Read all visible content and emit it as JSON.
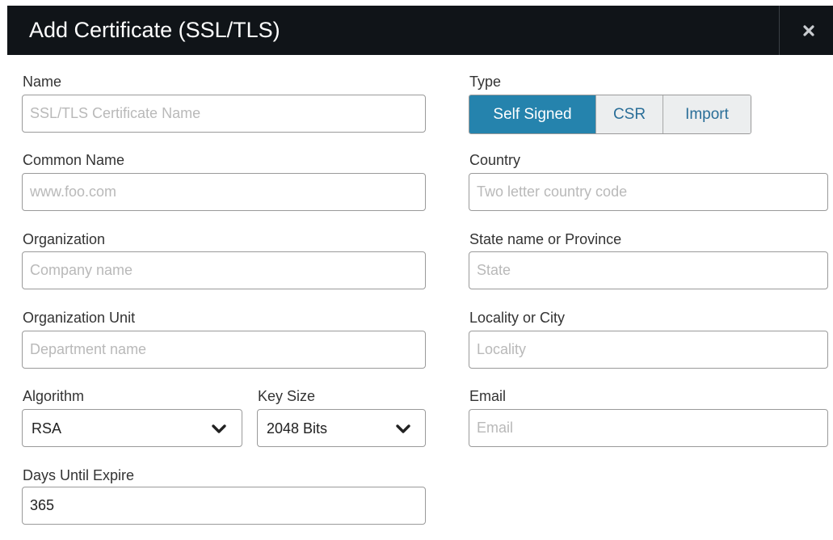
{
  "dialog": {
    "title": "Add Certificate (SSL/TLS)",
    "close_icon": "close-icon"
  },
  "form": {
    "name": {
      "label": "Name",
      "placeholder": "SSL/TLS Certificate Name",
      "value": ""
    },
    "type": {
      "label": "Type",
      "options": [
        "Self Signed",
        "CSR",
        "Import"
      ],
      "selected": "Self Signed"
    },
    "common_name": {
      "label": "Common Name",
      "placeholder": "www.foo.com",
      "value": ""
    },
    "country": {
      "label": "Country",
      "placeholder": "Two letter country code",
      "value": ""
    },
    "organization": {
      "label": "Organization",
      "placeholder": "Company name",
      "value": ""
    },
    "state": {
      "label": "State name or Province",
      "placeholder": "State",
      "value": ""
    },
    "org_unit": {
      "label": "Organization Unit",
      "placeholder": "Department name",
      "value": ""
    },
    "locality": {
      "label": "Locality or City",
      "placeholder": "Locality",
      "value": ""
    },
    "algorithm": {
      "label": "Algorithm",
      "value": "RSA",
      "icon": "chevron-down-icon"
    },
    "key_size": {
      "label": "Key Size",
      "value": "2048 Bits",
      "icon": "chevron-down-icon"
    },
    "email": {
      "label": "Email",
      "placeholder": "Email",
      "value": ""
    },
    "days_until_expire": {
      "label": "Days Until Expire",
      "value": "365"
    }
  },
  "colors": {
    "header_bg": "#101418",
    "accent": "#2583ad",
    "segment_inactive_text": "#2a6e98",
    "placeholder": "#b9b9b9"
  }
}
